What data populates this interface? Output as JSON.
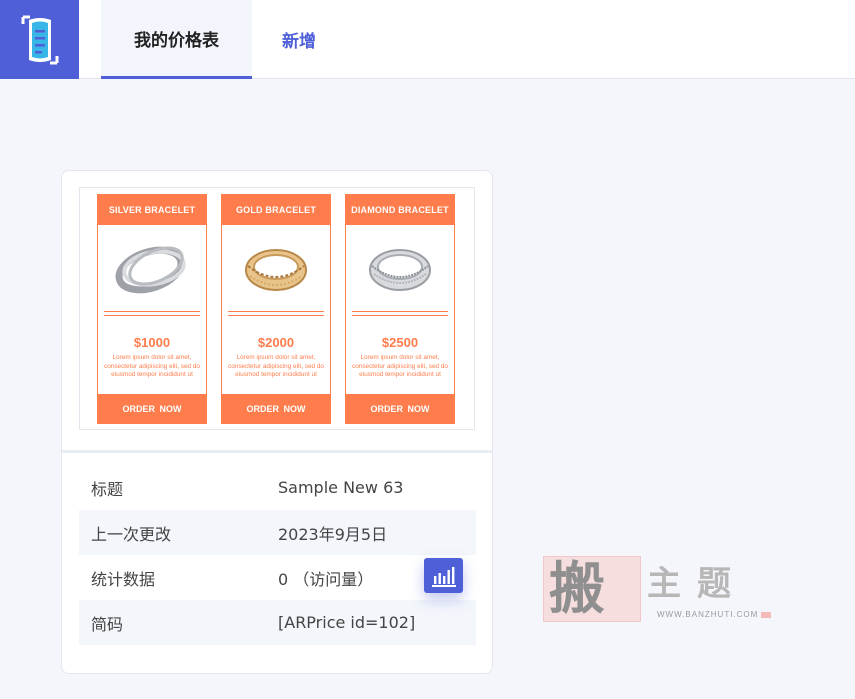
{
  "header": {
    "tabs": [
      {
        "label": "我的价格表",
        "active": true
      },
      {
        "label": "新增",
        "active": false
      }
    ]
  },
  "colors": {
    "brand": "#4e5fd8",
    "table_accent": "#ff7d4d",
    "background": "#f5f6fb"
  },
  "preview": {
    "columns": [
      {
        "title": "SILVER BRACELET",
        "price": "$1000",
        "desc": "Lorem ipsum dolor sit amet, consectetur adipiscing elit, sed do eiusmod tempor incididunt ut",
        "button": "ORDER NOW",
        "image": "silver-bracelet"
      },
      {
        "title": "GOLD BRACELET",
        "price": "$2000",
        "desc": "Lorem ipsum dolor sit amet, consectetur adipiscing elit, sed do eiusmod tempor incididunt ut",
        "button": "ORDER NOW",
        "image": "gold-bracelet"
      },
      {
        "title": "DIAMOND BRACELET",
        "price": "$2500",
        "desc": "Lorem ipsum dolor sit amet, consectetur adipiscing elit, sed do eiusmod tempor incididunt ut",
        "button": "ORDER NOW",
        "image": "diamond-bracelet"
      }
    ]
  },
  "details": [
    {
      "key": "标题",
      "value": "Sample New 63"
    },
    {
      "key": "上一次更改",
      "value": "2023年9月5日"
    },
    {
      "key": "统计数据",
      "value": "0 （访问量）"
    },
    {
      "key": "简码",
      "value": "[ARPrice id=102]"
    }
  ],
  "icons": {
    "logo": "document-scan-icon",
    "stats": "bar-chart-icon"
  },
  "watermark": {
    "big": "搬",
    "small": "主题",
    "url": "WWW.BANZHUTI.COM"
  }
}
